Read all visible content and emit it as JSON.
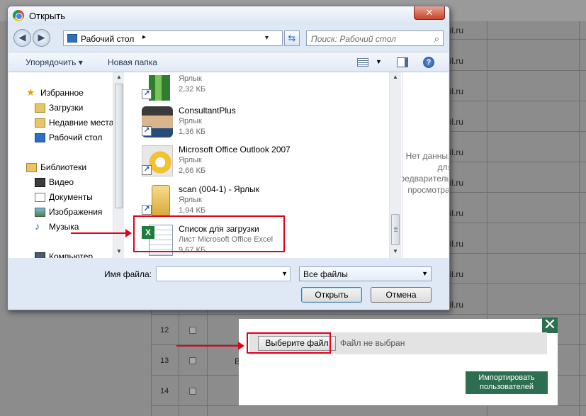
{
  "dialog": {
    "title": "Открыть",
    "address": "Рабочий стол",
    "search_placeholder": "Поиск: Рабочий стол",
    "toolbar": {
      "organize": "Упорядочить ▾",
      "new_folder": "Новая папка"
    },
    "nav": {
      "favorites": "Избранное",
      "downloads": "Загрузки",
      "recent": "Недавние места",
      "desktop": "Рабочий стол",
      "libraries": "Библиотеки",
      "video": "Видео",
      "documents": "Документы",
      "images": "Изображения",
      "music": "Музыка",
      "computer": "Компьютер"
    },
    "files": [
      {
        "name": "",
        "type": "Ярлык",
        "size": "2,32 КБ"
      },
      {
        "name": "ConsultantPlus",
        "type": "Ярлык",
        "size": "1,36 КБ"
      },
      {
        "name": "Microsoft Office Outlook 2007",
        "type": "Ярлык",
        "size": "2,66 КБ"
      },
      {
        "name": "scan (004-1) - Ярлык",
        "type": "Ярлык",
        "size": "1,94 КБ"
      },
      {
        "name": "Список для загрузки",
        "type": "Лист Microsoft Office Excel",
        "size": "9,67 КБ"
      }
    ],
    "preview_text": "Нет данных для предварительного просмотра.",
    "filename_label": "Имя файла:",
    "filename_value": "",
    "filter": "Все файлы",
    "open_label": "Открыть",
    "cancel_label": "Отмена"
  },
  "background": {
    "email_fragment": "ail.ru",
    "row_numbers": [
      "12",
      "13",
      "14"
    ],
    "row13_letter": "В"
  },
  "modal": {
    "choose_label": "Выберите файл",
    "no_file_text": "Файл не выбран",
    "import_label": "Импортировать пользователей",
    "accent": "#2c6e4f"
  },
  "highlight_color": "#e3001b"
}
